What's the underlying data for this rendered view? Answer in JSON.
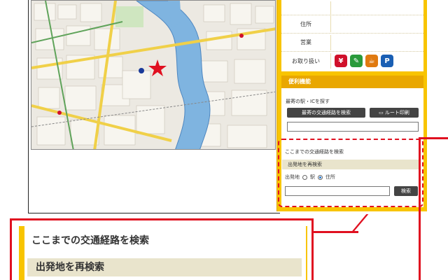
{
  "shop_info": {
    "address_label": "住所",
    "hours_label": "営業",
    "handling_label": "お取り扱い",
    "payment_icons": [
      {
        "name": "yen-icon",
        "glyph": "¥",
        "color": "#d0102a"
      },
      {
        "name": "card-icon",
        "glyph": "✎",
        "color": "#2a9a3a"
      },
      {
        "name": "coffee-icon",
        "glyph": "☕",
        "color": "#e07a10"
      },
      {
        "name": "parking-icon",
        "glyph": "P",
        "color": "#1a5fb4"
      }
    ]
  },
  "features": {
    "header": "便利機能",
    "nearest_title": "最寄の駅・ICを探す",
    "nearest_button": "最寄の交通経路を検索",
    "print_button": "ルート印刷",
    "route_search_title": "ここまでの交通経路を検索",
    "research_label": "出発地を再検索",
    "origin_label": "出発地",
    "option_station": "駅",
    "option_address": "住所",
    "search_button": "検索"
  },
  "zoom": {
    "title": "ここまでの交通経路を検索",
    "subtitle": "出発地を再検索"
  },
  "colors": {
    "accent": "#f8c400",
    "highlight": "#e01020"
  }
}
